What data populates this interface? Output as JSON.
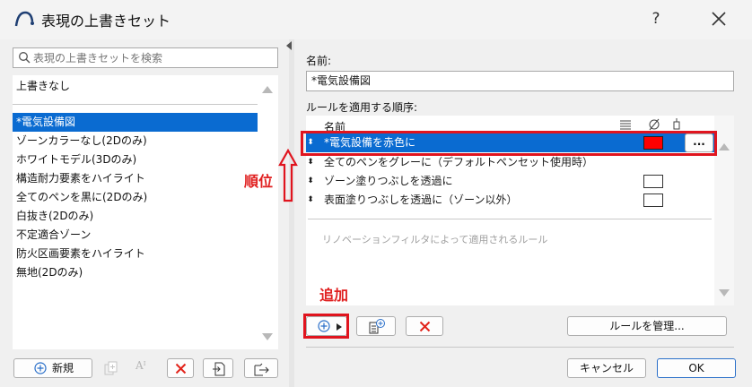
{
  "window": {
    "title": "表現の上書きセット",
    "help_label": "?"
  },
  "left": {
    "search_placeholder": "表現の上書きセットを検索",
    "items": [
      {
        "label": "上書きなし"
      },
      {
        "label": "*電気設備図",
        "selected": true
      },
      {
        "label": "ゾーンカラーなし(2Dのみ)"
      },
      {
        "label": "ホワイトモデル(3Dのみ)"
      },
      {
        "label": "構造耐力要素をハイライト"
      },
      {
        "label": "全てのペンを黒に(2Dのみ)"
      },
      {
        "label": "白抜き(2Dのみ)"
      },
      {
        "label": "不定適合ゾーン"
      },
      {
        "label": "防火区画要素をハイライト"
      },
      {
        "label": "無地(2Dのみ)"
      }
    ],
    "new_button": "新規",
    "rename_label": "Aᴵ"
  },
  "right": {
    "name_label": "名前:",
    "name_value": "*電気設備図",
    "rules_label": "ルールを適用する順序:",
    "header_name": "名前",
    "rules": [
      {
        "label": "*電気設備を赤色に",
        "selected": true,
        "swatch": "#ff0000",
        "more": "..."
      },
      {
        "label": "全てのペンをグレーに（デフォルトペンセット使用時）"
      },
      {
        "label": "ゾーン塗りつぶしを透過に",
        "swatch": "#ffffff"
      },
      {
        "label": "表面塗りつぶしを透過に（ゾーン以外）",
        "swatch": "#ffffff"
      }
    ],
    "hint": "リノベーションフィルタによって適用されるルール",
    "manage_rules": "ルールを管理...",
    "cancel": "キャンセル",
    "ok": "OK"
  },
  "annotations": {
    "order": "順位",
    "add": "追加"
  },
  "colors": {
    "selection": "#0a6bd1",
    "annotation_red": "#e0141e",
    "swatch_red": "#ff0000"
  }
}
